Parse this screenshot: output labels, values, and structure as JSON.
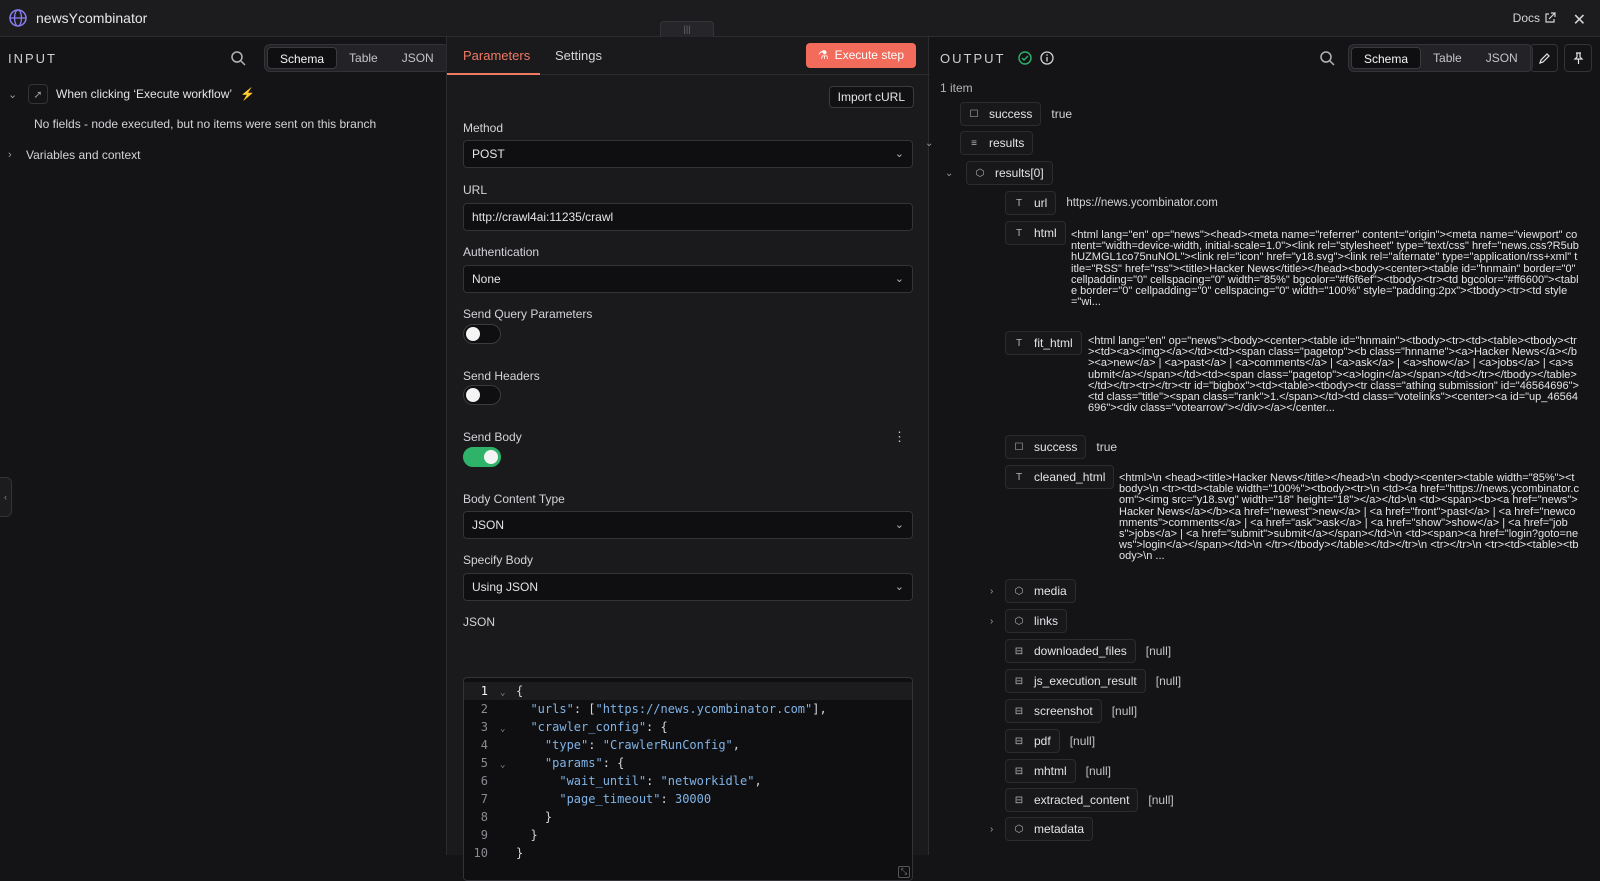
{
  "app": {
    "title": "newsYcombinator",
    "docs_label": "Docs"
  },
  "input": {
    "label": "INPUT",
    "views": [
      "Schema",
      "Table",
      "JSON"
    ],
    "active_view": "Schema",
    "trigger_label": "When clicking ‘Execute workflow’",
    "no_fields_text": "No fields - node executed, but no items were sent on this branch",
    "vars_label": "Variables and context"
  },
  "params": {
    "tabs": [
      "Parameters",
      "Settings"
    ],
    "execute_label": "Execute step",
    "import_label": "Import cURL",
    "method_label": "Method",
    "method_value": "POST",
    "url_label": "URL",
    "url_value": "http://crawl4ai:11235/crawl",
    "auth_label": "Authentication",
    "auth_value": "None",
    "send_query_label": "Send Query Parameters",
    "send_query_on": false,
    "send_headers_label": "Send Headers",
    "send_headers_on": false,
    "send_body_label": "Send Body",
    "send_body_on": true,
    "body_type_label": "Body Content Type",
    "body_type_value": "JSON",
    "specify_body_label": "Specify Body",
    "specify_body_value": "Using JSON",
    "json_label": "JSON",
    "code_lines": [
      "{",
      "  \"urls\": [\"https://news.ycombinator.com\"],",
      "  \"crawler_config\": {",
      "    \"type\": \"CrawlerRunConfig\",",
      "    \"params\": {",
      "      \"wait_until\": \"networkidle\",",
      "      \"page_timeout\": 30000",
      "    }",
      "  }",
      "}"
    ]
  },
  "output": {
    "label": "OUTPUT",
    "views": [
      "Schema",
      "Table",
      "JSON"
    ],
    "active_view": "Schema",
    "item_count": "1 item",
    "rows": {
      "success": {
        "key": "success",
        "value": "true"
      },
      "results": {
        "key": "results"
      },
      "results0": {
        "key": "results[0]"
      },
      "url": {
        "key": "url",
        "value": "https://news.ycombinator.com"
      },
      "html": {
        "key": "html",
        "value": "<html lang=\"en\" op=\"news\"><head><meta name=\"referrer\" content=\"origin\"><meta name=\"viewport\" content=\"width=device-width, initial-scale=1.0\"><link rel=\"stylesheet\" type=\"text/css\" href=\"news.css?R5ubhUZMGL1co75nuNOL\"><link rel=\"icon\" href=\"y18.svg\"><link rel=\"alternate\" type=\"application/rss+xml\" title=\"RSS\" href=\"rss\"><title>Hacker News</title></head><body><center><table id=\"hnmain\" border=\"0\" cellpadding=\"0\" cellspacing=\"0\" width=\"85%\" bgcolor=\"#f6f6ef\"><tbody><tr><td bgcolor=\"#ff6600\"><table border=\"0\" cellpadding=\"0\" cellspacing=\"0\" width=\"100%\" style=\"padding:2px\"><tbody><tr><td style=\"wi..."
      },
      "fit_html": {
        "key": "fit_html",
        "value": "<html lang=\"en\" op=\"news\"><body><center><table id=\"hnmain\"><tbody><tr><td><table><tbody><tr><td><a><img></a></td><td><span class=\"pagetop\"><b class=\"hnname\"><a>Hacker News</a></b><a>new</a> | <a>past</a> | <a>comments</a> | <a>ask</a> | <a>show</a> | <a>jobs</a> | <a>submit</a></span></td><td><span class=\"pagetop\"><a>login</a></span></td></tr></tbody></table></td></tr><tr></tr><tr id=\"bigbox\"><td><table><tbody><tr class=\"athing submission\" id=\"46564696\"><td class=\"title\"><span class=\"rank\">1.</span></td><td class=\"votelinks\"><center><a id=\"up_46564696\"><div class=\"votearrow\"></div></a></center..."
      },
      "success2": {
        "key": "success",
        "value": "true"
      },
      "cleaned_html": {
        "key": "cleaned_html",
        "value": "<html>\\n <head><title>Hacker News</title></head>\\n <body><center><table width=\"85%\"><tbody>\\n <tr><td><table width=\"100%\"><tbody><tr>\\n <td><a href=\"https://news.ycombinator.com\"><img src=\"y18.svg\" width=\"18\" height=\"18\"></a></td>\\n <td><span><b><a href=\"news\">Hacker News</a></b><a href=\"newest\">new</a> | <a href=\"front\">past</a> | <a href=\"newcomments\">comments</a> | <a href=\"ask\">ask</a> | <a href=\"show\">show</a> | <a href=\"jobs\">jobs</a> | <a href=\"submit\">submit</a></span></td>\\n <td><span><a href=\"login?goto=news\">login</a></span></td>\\n </tr></tbody></table></td></tr>\\n <tr></tr>\\n <tr><td><table><tbody>\\n ..."
      },
      "media": {
        "key": "media"
      },
      "links": {
        "key": "links"
      },
      "downloaded_files": {
        "key": "downloaded_files",
        "value": "[null]"
      },
      "js_execution_result": {
        "key": "js_execution_result",
        "value": "[null]"
      },
      "screenshot": {
        "key": "screenshot",
        "value": "[null]"
      },
      "pdf": {
        "key": "pdf",
        "value": "[null]"
      },
      "mhtml": {
        "key": "mhtml",
        "value": "[null]"
      },
      "extracted_content": {
        "key": "extracted_content",
        "value": "[null]"
      },
      "metadata": {
        "key": "metadata"
      }
    }
  },
  "colors": {
    "accent": "#f26b5b",
    "toggle_on": "#2fb36a",
    "success": "#2fb36a"
  }
}
